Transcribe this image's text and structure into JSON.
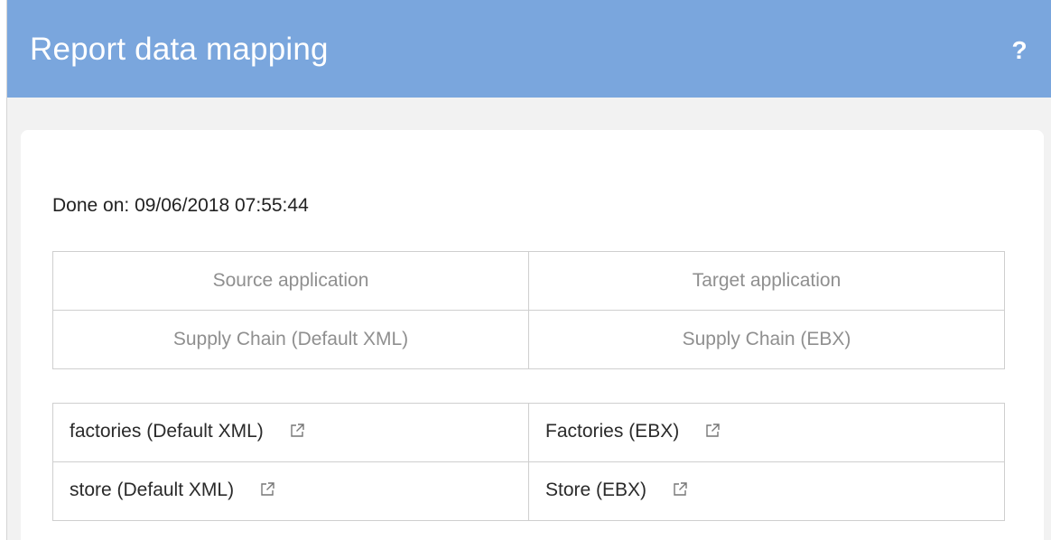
{
  "header": {
    "title": "Report data mapping",
    "help_label": "?"
  },
  "report": {
    "done_on": "Done on: 09/06/2018 07:55:44"
  },
  "applications": {
    "headers": [
      "Source application",
      "Target application"
    ],
    "values": [
      "Supply Chain (Default XML)",
      "Supply Chain (EBX)"
    ]
  },
  "mappings": [
    {
      "source": "factories (Default XML)",
      "target": "Factories (EBX)"
    },
    {
      "source": "store (Default XML)",
      "target": "Store (EBX)"
    }
  ],
  "icons": {
    "external_link": "external-link-icon"
  },
  "colors": {
    "header_bg": "#7aa6dd",
    "panel_bg": "#f2f2f2",
    "card_bg": "#ffffff",
    "border": "#cfcfcf"
  }
}
